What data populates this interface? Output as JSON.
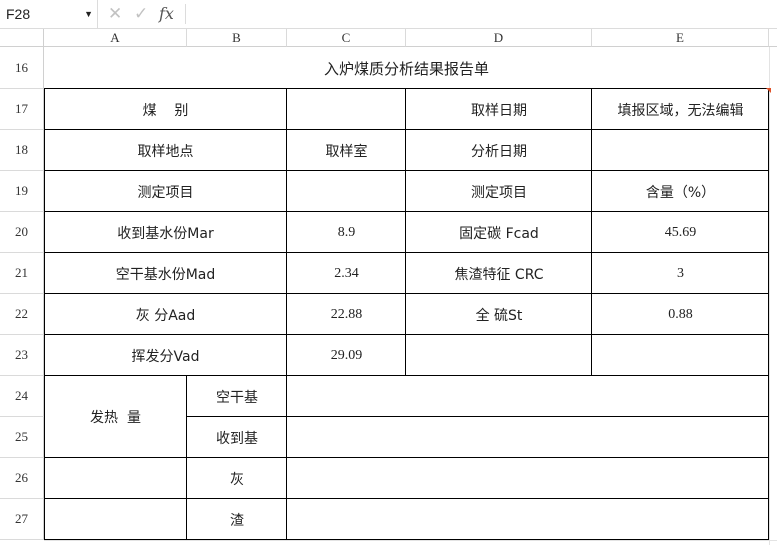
{
  "formula_bar": {
    "cell_ref": "F28",
    "cancel_glyph": "✕",
    "confirm_glyph": "✓",
    "fx_label": "fx"
  },
  "columns": [
    "A",
    "B",
    "C",
    "D",
    "E"
  ],
  "rows": [
    "16",
    "17",
    "18",
    "19",
    "20",
    "21",
    "22",
    "23",
    "24",
    "25",
    "26",
    "27"
  ],
  "report": {
    "title": "入炉煤质分析结果报告单",
    "coal_type_label": "煤    别",
    "sampling_date_label": "取样日期",
    "sampling_date_value": "填报区域，无法编辑",
    "sampling_location_label": "取样地点",
    "sampling_location_value": "取样室",
    "analysis_date_label": "分析日期",
    "test_item_label_left": "测定项目",
    "test_item_label_right": "测定项目",
    "content_label": "含量（%）",
    "mar_label": "收到基水份Mar",
    "mar_value": "8.9",
    "fcad_label": "固定碳 Fcad",
    "fcad_value": "45.69",
    "mad_label": "空干基水份Mad",
    "mad_value": "2.34",
    "crc_label": "焦渣特征 CRC",
    "crc_value": "3",
    "aad_label": "灰 分Aad",
    "aad_value": "22.88",
    "st_label": "全 硫St",
    "st_value": "0.88",
    "vad_label": "挥发分Vad",
    "vad_value": "29.09",
    "calorific_label": "发热  量",
    "air_dry_label": "空干基",
    "as_received_label": "收到基",
    "ash_label": "灰",
    "slag_label": "渣"
  }
}
